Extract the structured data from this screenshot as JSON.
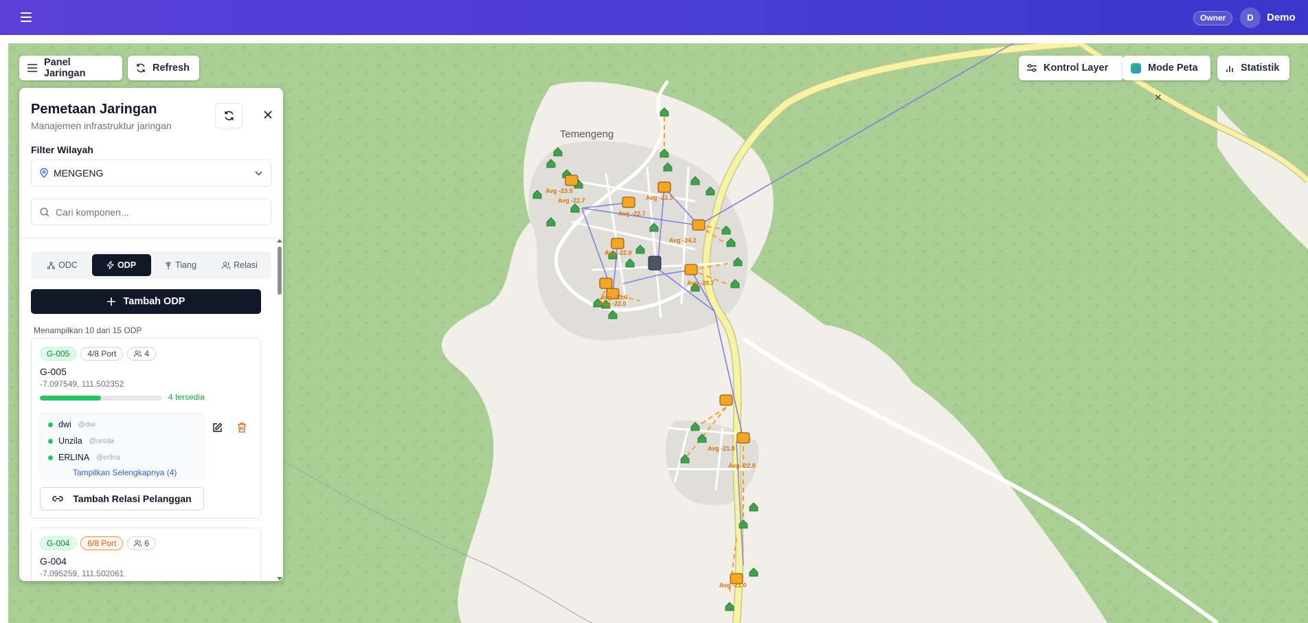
{
  "topbar": {
    "menu_icon": "hamburger-icon",
    "role_badge": "Owner",
    "avatar_initial": "D",
    "user_name": "Demo"
  },
  "toolbar": {
    "panel_label": "Panel Jaringan",
    "refresh_label": "Refresh",
    "layers_label": "Kontrol Layer",
    "map_mode_label": "Mode Peta",
    "stats_label": "Statistik"
  },
  "map": {
    "village_label": "Temengeng",
    "avg_labels": [
      "Avg -23.5",
      "Avg -22.7",
      "Avg -22.7",
      "Avg -23.5",
      "Avg -24.2",
      "Avg -22.0",
      "Avg -22.0",
      "Avg -20.7",
      "Avg -23.6",
      "Avg -21.8",
      "Avg -22.0",
      "Avg -21.0"
    ],
    "colors": {
      "land": "#f2efe9",
      "forest": "#a9cf94",
      "road": "#ffffff",
      "main_road": "#f7f3a5",
      "fiber_line": "#8a7be0",
      "drop_cable": "#f59e2a",
      "node": "#f6a623",
      "customer": "#3fa34d"
    }
  },
  "panel": {
    "title": "Pemetaan Jaringan",
    "subtitle": "Manajemen infrastruktur jaringan",
    "filter_label": "Filter Wilayah",
    "filter_value": "MENGENG",
    "search_placeholder": "Cari komponen...",
    "tabs": [
      {
        "label": "ODC",
        "icon": "network-icon"
      },
      {
        "label": "ODP",
        "icon": "zap-icon"
      },
      {
        "label": "Tiang",
        "icon": "pole-icon"
      },
      {
        "label": "Relasi",
        "icon": "users-icon"
      }
    ],
    "active_tab": "ODP",
    "add_button": "Tambah ODP",
    "count_text": "Menampilkan 10 dari 15 ODP",
    "cards": [
      {
        "code": "G-005",
        "ports": "4/8 Port",
        "customers_count": "4",
        "name": "G-005",
        "coords": "-7.097549, 111.502352",
        "usage": 0.5,
        "available": "4 tersedia",
        "customers": [
          {
            "name": "dwi",
            "user": "@dwi"
          },
          {
            "name": "Unzila",
            "user": "@unzila"
          },
          {
            "name": "ERLINA",
            "user": "@erlina"
          }
        ],
        "more": "Tampilkan Selengkapnya (4)",
        "relation_button": "Tambah Relasi Pelanggan"
      },
      {
        "code": "G-004",
        "ports": "6/8 Port",
        "customers_count": "6",
        "name": "G-004",
        "coords": "-7.095259, 111.502061"
      }
    ]
  }
}
